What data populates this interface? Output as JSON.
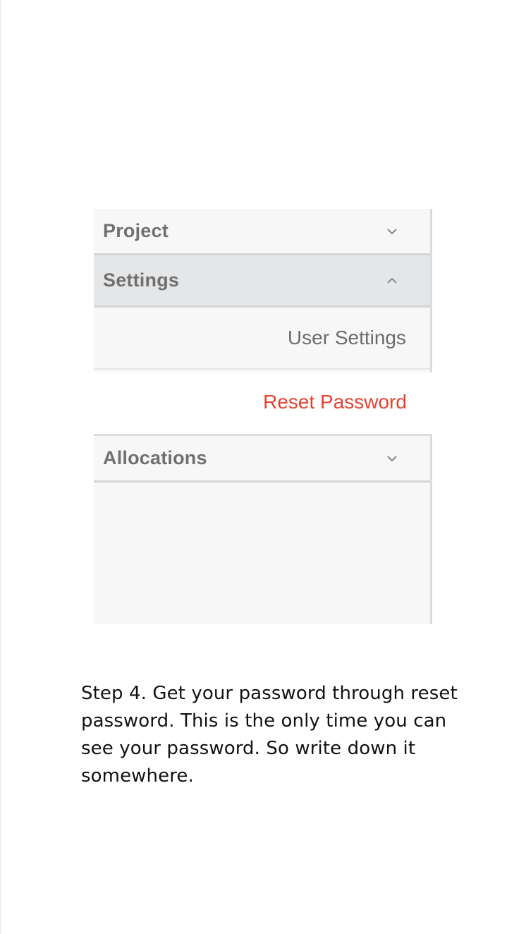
{
  "menu": {
    "sections": [
      {
        "label": "Project",
        "expanded": false,
        "chevron_icon": "chevron-down-icon"
      },
      {
        "label": "Settings",
        "expanded": true,
        "chevron_icon": "chevron-up-icon"
      },
      {
        "label": "Allocations",
        "expanded": false,
        "chevron_icon": "chevron-down-icon"
      }
    ],
    "settings_items": [
      {
        "label": "User Settings"
      },
      {
        "label": "Reset Password",
        "color": "#e5412f"
      }
    ]
  },
  "caption": {
    "text": "Step 4. Get your password through reset password. This is the only time you can see your password. So write down it somewhere."
  }
}
